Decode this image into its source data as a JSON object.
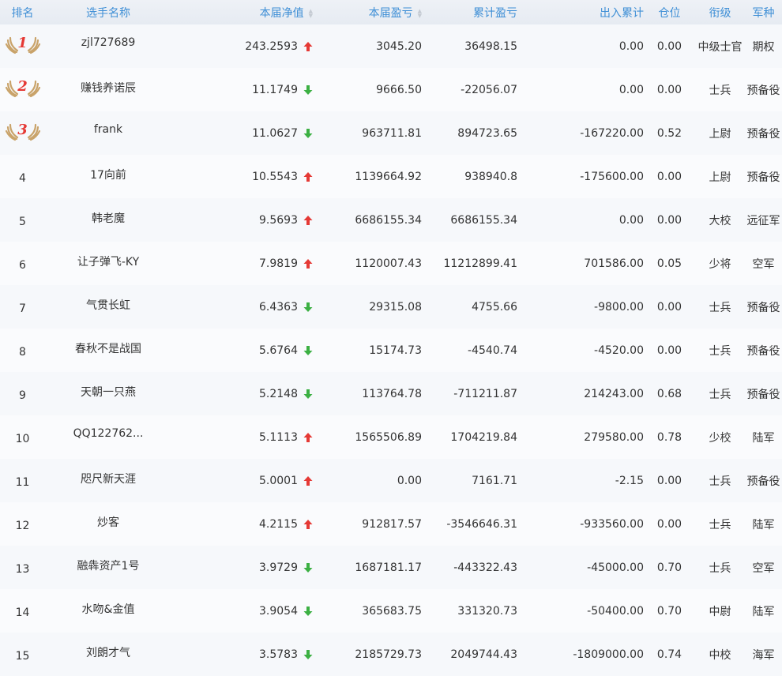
{
  "headers": {
    "rank": "排名",
    "name": "选手名称",
    "nav": "本届净值",
    "pnl": "本届盈亏",
    "cum_pnl": "累计盈亏",
    "flow": "出入累计",
    "position": "仓位",
    "grade": "衔级",
    "branch": "军种"
  },
  "colors": {
    "header_text": "#3f8fd6",
    "up": "#e53935",
    "down": "#3cb043",
    "medal": "#c9a36a"
  },
  "rows": [
    {
      "rank": "1",
      "name": "zjl727689",
      "nav": "243.2593",
      "trend": "up",
      "pnl": "3045.20",
      "cum": "36498.15",
      "flow": "0.00",
      "pos": "0.00",
      "grade": "中级士官",
      "branch": "期权"
    },
    {
      "rank": "2",
      "name": "赚钱养诺辰",
      "nav": "11.1749",
      "trend": "down",
      "pnl": "9666.50",
      "cum": "-22056.07",
      "flow": "0.00",
      "pos": "0.00",
      "grade": "士兵",
      "branch": "预备役"
    },
    {
      "rank": "3",
      "name": "frank",
      "nav": "11.0627",
      "trend": "down",
      "pnl": "963711.81",
      "cum": "894723.65",
      "flow": "-167220.00",
      "pos": "0.52",
      "grade": "上尉",
      "branch": "预备役"
    },
    {
      "rank": "4",
      "name": "17向前",
      "nav": "10.5543",
      "trend": "up",
      "pnl": "1139664.92",
      "cum": "938940.8",
      "flow": "-175600.00",
      "pos": "0.00",
      "grade": "上尉",
      "branch": "预备役"
    },
    {
      "rank": "5",
      "name": "韩老魔",
      "nav": "9.5693",
      "trend": "up",
      "pnl": "6686155.34",
      "cum": "6686155.34",
      "flow": "0.00",
      "pos": "0.00",
      "grade": "大校",
      "branch": "远征军"
    },
    {
      "rank": "6",
      "name": "让子弹飞-KY",
      "nav": "7.9819",
      "trend": "up",
      "pnl": "1120007.43",
      "cum": "11212899.41",
      "flow": "701586.00",
      "pos": "0.05",
      "grade": "少将",
      "branch": "空军"
    },
    {
      "rank": "7",
      "name": "气贯长虹",
      "nav": "6.4363",
      "trend": "down",
      "pnl": "29315.08",
      "cum": "4755.66",
      "flow": "-9800.00",
      "pos": "0.00",
      "grade": "士兵",
      "branch": "预备役"
    },
    {
      "rank": "8",
      "name": "春秋不是战国",
      "nav": "5.6764",
      "trend": "down",
      "pnl": "15174.73",
      "cum": "-4540.74",
      "flow": "-4520.00",
      "pos": "0.00",
      "grade": "士兵",
      "branch": "预备役"
    },
    {
      "rank": "9",
      "name": "天朝一只燕",
      "nav": "5.2148",
      "trend": "down",
      "pnl": "113764.78",
      "cum": "-711211.87",
      "flow": "214243.00",
      "pos": "0.68",
      "grade": "士兵",
      "branch": "预备役"
    },
    {
      "rank": "10",
      "name": "QQ122762...",
      "nav": "5.1113",
      "trend": "up",
      "pnl": "1565506.89",
      "cum": "1704219.84",
      "flow": "279580.00",
      "pos": "0.78",
      "grade": "少校",
      "branch": "陆军"
    },
    {
      "rank": "11",
      "name": "咫尺新天涯",
      "nav": "5.0001",
      "trend": "up",
      "pnl": "0.00",
      "cum": "7161.71",
      "flow": "-2.15",
      "pos": "0.00",
      "grade": "士兵",
      "branch": "预备役"
    },
    {
      "rank": "12",
      "name": "炒客",
      "nav": "4.2115",
      "trend": "up",
      "pnl": "912817.57",
      "cum": "-3546646.31",
      "flow": "-933560.00",
      "pos": "0.00",
      "grade": "士兵",
      "branch": "陆军"
    },
    {
      "rank": "13",
      "name": "融犇资产1号",
      "nav": "3.9729",
      "trend": "down",
      "pnl": "1687181.17",
      "cum": "-443322.43",
      "flow": "-45000.00",
      "pos": "0.70",
      "grade": "士兵",
      "branch": "空军"
    },
    {
      "rank": "14",
      "name": "水吻&金值",
      "nav": "3.9054",
      "trend": "down",
      "pnl": "365683.75",
      "cum": "331320.73",
      "flow": "-50400.00",
      "pos": "0.70",
      "grade": "中尉",
      "branch": "陆军"
    },
    {
      "rank": "15",
      "name": "刘朗才气",
      "nav": "3.5783",
      "trend": "down",
      "pnl": "2185729.73",
      "cum": "2049744.43",
      "flow": "-1809000.00",
      "pos": "0.74",
      "grade": "中校",
      "branch": "海军"
    }
  ]
}
